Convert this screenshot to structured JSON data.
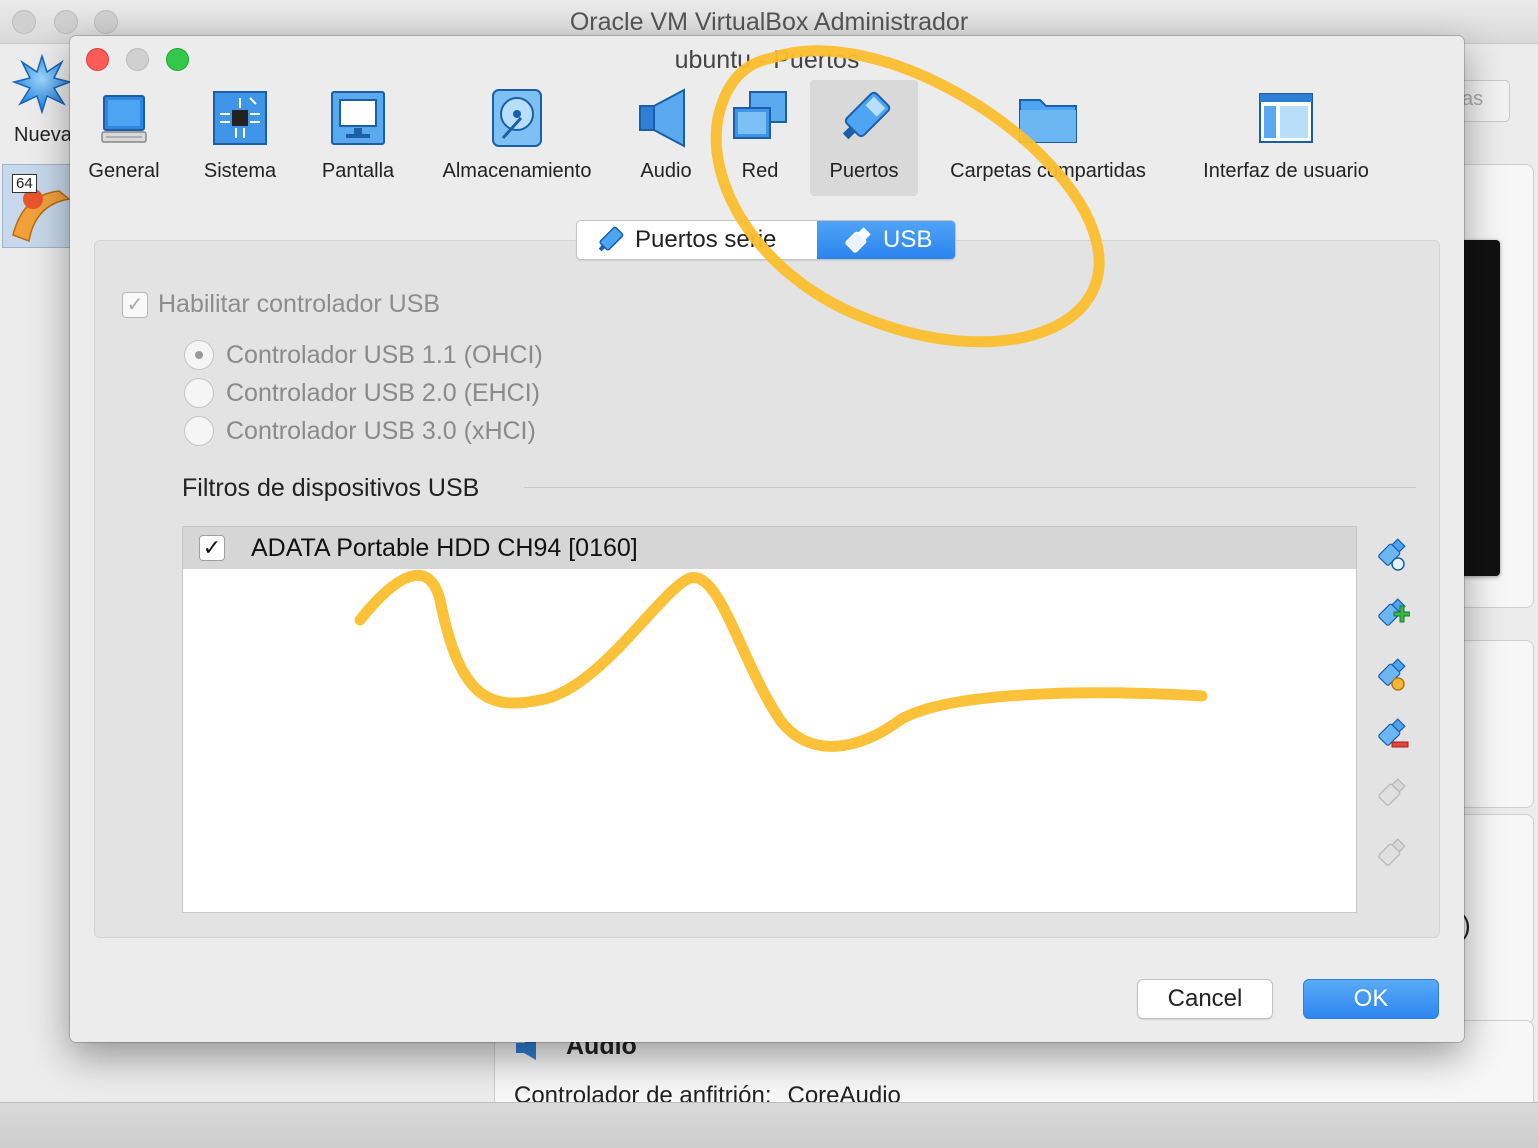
{
  "background_window": {
    "title": "Oracle VM VirtualBox Administrador",
    "new_button_label": "Nueva",
    "vm_badge": "64",
    "right_button_label": "as",
    "audio_section_title": "Audio",
    "audio_row_label": "Controlador de anfitrión:",
    "audio_row_value": "CoreAudio",
    "paren_fragment": ")"
  },
  "dialog": {
    "title": "ubuntu - Puertos",
    "toolbar": [
      {
        "label": "General",
        "icon": "general-icon"
      },
      {
        "label": "Sistema",
        "icon": "system-chip-icon"
      },
      {
        "label": "Pantalla",
        "icon": "display-monitor-icon"
      },
      {
        "label": "Almacenamiento",
        "icon": "storage-disk-icon"
      },
      {
        "label": "Audio",
        "icon": "speaker-icon"
      },
      {
        "label": "Red",
        "icon": "network-icon"
      },
      {
        "label": "Puertos",
        "icon": "ports-connector-icon",
        "active": true
      },
      {
        "label": "Carpetas compartidas",
        "icon": "shared-folder-icon"
      },
      {
        "label": "Interfaz de usuario",
        "icon": "user-interface-window-icon"
      }
    ],
    "tabs": {
      "serial_label": "Puertos serie",
      "usb_label": "USB",
      "selected": "USB"
    },
    "usb": {
      "enable_label": "Habilitar controlador USB",
      "enable_checked": true,
      "controllers": [
        {
          "label": "Controlador USB 1.1 (OHCI)",
          "selected": true
        },
        {
          "label": "Controlador USB 2.0 (EHCI)",
          "selected": false
        },
        {
          "label": "Controlador USB 3.0 (xHCI)",
          "selected": false
        }
      ],
      "filters_title": "Filtros de dispositivos USB",
      "filters": [
        {
          "label": "ADATA Portable HDD CH94 [0160]",
          "checked": true
        }
      ],
      "side_tools": [
        {
          "name": "add-empty-filter-icon",
          "enabled": true
        },
        {
          "name": "add-filter-from-device-icon",
          "enabled": true
        },
        {
          "name": "edit-filter-icon",
          "enabled": true
        },
        {
          "name": "remove-filter-icon",
          "enabled": true
        },
        {
          "name": "move-filter-up-icon",
          "enabled": false
        },
        {
          "name": "move-filter-down-icon",
          "enabled": false
        }
      ]
    },
    "buttons": {
      "cancel": "Cancel",
      "ok": "OK"
    }
  },
  "colors": {
    "accent_blue": "#2a84ee",
    "annotation_yellow": "#fbbf2e",
    "close_red": "#fc5b57",
    "zoom_green": "#34c84a"
  }
}
